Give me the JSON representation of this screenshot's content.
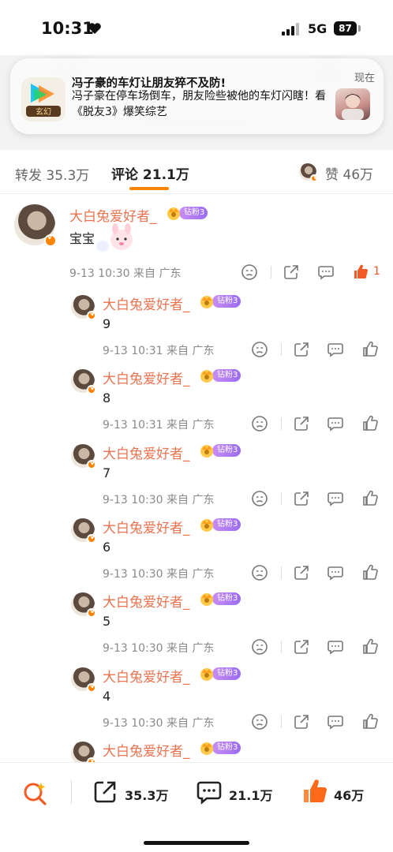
{
  "status_bar": {
    "time": "10:31",
    "network": "5G",
    "battery": "87"
  },
  "notification": {
    "title": "冯子豪的车灯让朋友猝不及防!",
    "body": "冯子豪在停车场倒车，朋友险些被他的车灯闪瞎！看《脱友3》爆笑综艺",
    "time": "现在",
    "app_icon": "tencent-video-icon"
  },
  "tabs": {
    "repost_label": "转发 35.3万",
    "comment_label": "评论 21.1万",
    "like_label": "赞 46万",
    "accent": "#ff8200"
  },
  "main_comment": {
    "username": "大白兔爱好者_",
    "fan_badge": "钻粉3",
    "text": "宝宝",
    "meta": "9-13 10:30 来自 广东",
    "like_count": "1"
  },
  "replies": [
    {
      "username": "大白兔爱好者_",
      "fan_badge": "钻粉3",
      "text": "9",
      "meta": "9-13 10:31 来自 广东"
    },
    {
      "username": "大白兔爱好者_",
      "fan_badge": "钻粉3",
      "text": "8",
      "meta": "9-13 10:31 来自 广东"
    },
    {
      "username": "大白兔爱好者_",
      "fan_badge": "钻粉3",
      "text": "7",
      "meta": "9-13 10:30 来自 广东"
    },
    {
      "username": "大白兔爱好者_",
      "fan_badge": "钻粉3",
      "text": "6",
      "meta": "9-13 10:30 来自 广东"
    },
    {
      "username": "大白兔爱好者_",
      "fan_badge": "钻粉3",
      "text": "5",
      "meta": "9-13 10:30 来自 广东"
    },
    {
      "username": "大白兔爱好者_",
      "fan_badge": "钻粉3",
      "text": "4",
      "meta": "9-13 10:30 来自 广东"
    },
    {
      "username": "大白兔爱好者_",
      "fan_badge": "钻粉3",
      "text": "",
      "meta": ""
    }
  ],
  "bottom_bar": {
    "repost_count": "35.3万",
    "comment_count": "21.1万",
    "like_count": "46万"
  },
  "colors": {
    "username": "#eb7350",
    "like_active": "#f35b26",
    "badge": "#9a6cf0"
  }
}
